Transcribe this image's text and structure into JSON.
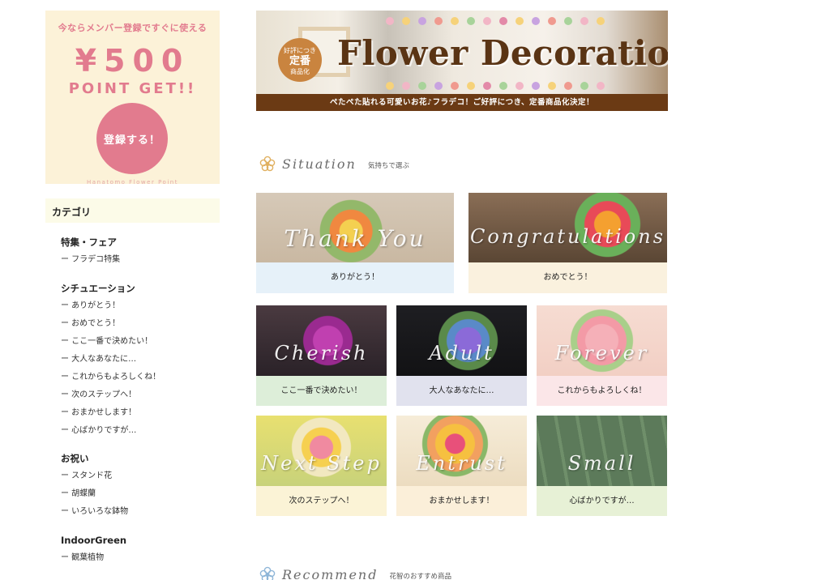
{
  "promo": {
    "lead": "今ならメンバー登録ですぐに使える",
    "amount": "¥500",
    "point_get": "POINT GET!!",
    "button_label": "登録する！",
    "footer": "Hanatomo Flower Point"
  },
  "sidebar": {
    "heading": "カテゴリ",
    "groups": [
      {
        "title": "特集・フェア",
        "items": [
          "ー フラデコ特集"
        ]
      },
      {
        "title": "シチュエーション",
        "items": [
          "ー ありがとう！",
          "ー おめでとう！",
          "ー ここ一番で決めたい！",
          "ー 大人なあなたに…",
          "ー これからもよろしくね！",
          "ー 次のステップへ！",
          "ー おまかせします！",
          "ー 心ばかりですが…"
        ]
      },
      {
        "title": "お祝い",
        "items": [
          "ー スタンド花",
          "ー 胡蝶蘭",
          "ー いろいろな鉢物"
        ]
      },
      {
        "title": "IndoorGreen",
        "items": [
          "ー 観葉植物"
        ]
      }
    ]
  },
  "banner": {
    "stamp_small": "好評につき",
    "stamp_big": "定番",
    "stamp_bottom": "商品化",
    "title": "Flower Decoration",
    "caption": "ぺたぺた貼れる可愛いお花♪フラデコ！ご好評につき、定番商品化決定！"
  },
  "situation": {
    "title_en": "Situation",
    "title_jp": "気持ちで選ぶ",
    "cards": [
      {
        "en": "Thank You",
        "label": "ありがとう！",
        "band": "#e6f1f9"
      },
      {
        "en": "Congratulations",
        "label": "おめでとう！",
        "band": "#faf1de"
      },
      {
        "en": "Cherish",
        "label": "ここ一番で決めたい！",
        "band": "#ddeed9"
      },
      {
        "en": "Adult",
        "label": "大人なあなたに…",
        "band": "#e1e2ee"
      },
      {
        "en": "Forever",
        "label": "これからもよろしくね！",
        "band": "#fbe6e8"
      },
      {
        "en": "Next Step",
        "label": "次のステップへ！",
        "band": "#fbf3d6"
      },
      {
        "en": "Entrust",
        "label": "おまかせします！",
        "band": "#fbefd9"
      },
      {
        "en": "Small",
        "label": "心ばかりですが…",
        "band": "#e7f1d6"
      }
    ]
  },
  "recommend": {
    "title_en": "Recommend",
    "title_jp": "花智のおすすめ商品"
  }
}
